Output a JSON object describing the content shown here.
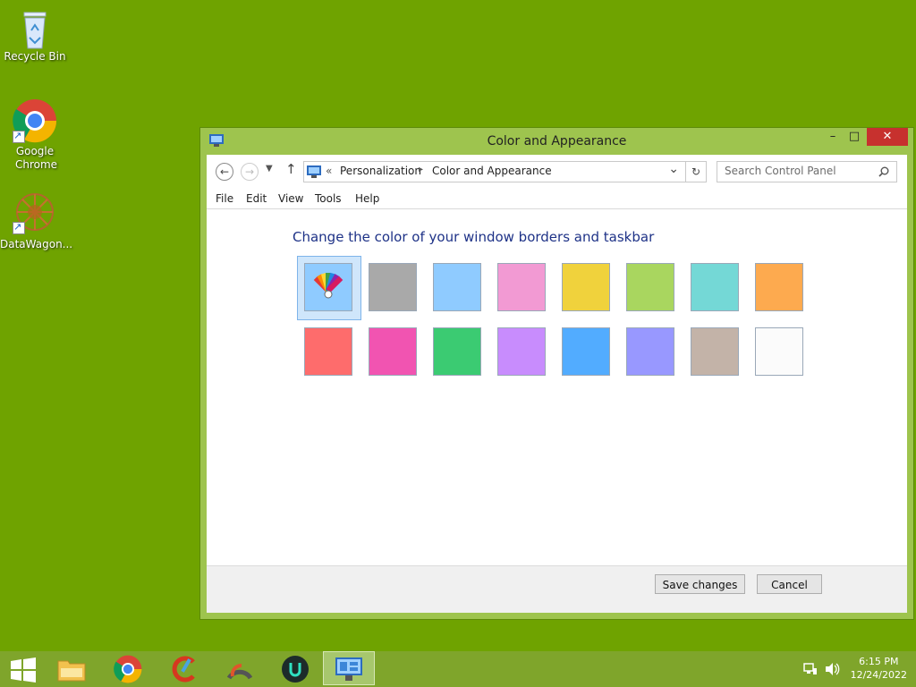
{
  "desktop": {
    "icons": [
      {
        "label": "Recycle Bin"
      },
      {
        "label": "Google Chrome"
      },
      {
        "label": "DataWagon..."
      }
    ]
  },
  "window": {
    "title": "Color and Appearance",
    "minimize_glyph": "–",
    "maximize_glyph": "□",
    "close_glyph": "✕",
    "address": {
      "prefix": "«",
      "crumb1": "Personalization",
      "sep": "▸",
      "crumb2": "Color and Appearance",
      "dropdown": "⌄",
      "refresh": "↻"
    },
    "search_placeholder": "Search Control Panel",
    "menu": [
      "File",
      "Edit",
      "View",
      "Tools",
      "Help"
    ],
    "heading": "Change the color of your window borders and taskbar",
    "swatches": [
      [
        "#ffffff",
        "#a9a9a9",
        "#8fcbff",
        "#f29ad3",
        "#f0d23c",
        "#a9d65f",
        "#74d8d6",
        "#fdaa4f"
      ],
      [
        "#fe6c6c",
        "#f154b1",
        "#3bcb72",
        "#c88cfd",
        "#52acff",
        "#9898ff",
        "#c3b3a8",
        "#fbfbfb"
      ]
    ],
    "buttons": {
      "save": "Save changes",
      "cancel": "Cancel"
    }
  },
  "taskbar": {
    "time": "6:15 PM",
    "date": "12/24/2022"
  },
  "colors": {
    "desktop": "#6fa300",
    "window_border": "#9ec44e",
    "heading": "#1e3287"
  }
}
